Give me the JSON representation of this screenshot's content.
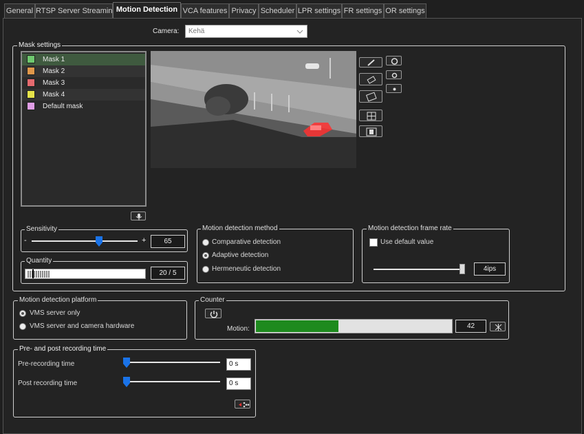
{
  "tabs": [
    "General",
    "RTSP Server Streaming",
    "Motion Detection",
    "VCA features",
    "Privacy",
    "Scheduler",
    "LPR settings",
    "FR settings",
    "OR settings"
  ],
  "active_tab": "Motion Detection",
  "camera": {
    "label": "Camera:",
    "value": "Kehä"
  },
  "mask_settings": {
    "legend": "Mask settings",
    "masks": [
      {
        "label": "Mask 1",
        "color": "#6fc96f",
        "selected": true
      },
      {
        "label": "Mask 2",
        "color": "#e0974a"
      },
      {
        "label": "Mask 3",
        "color": "#e56a6f"
      },
      {
        "label": "Mask 4",
        "color": "#e6e34a"
      },
      {
        "label": "Default mask",
        "color": "#e09ee6"
      }
    ]
  },
  "sensitivity": {
    "legend": "Sensitivity",
    "value": "65",
    "minus": "-",
    "plus": "+",
    "level_percent": 65
  },
  "quantity": {
    "legend": "Quantity",
    "value": "20 / 5"
  },
  "method": {
    "legend": "Motion detection method",
    "options": [
      "Comparative detection",
      "Adaptive detection",
      "Hermeneutic detection"
    ],
    "selected": "Adaptive detection"
  },
  "frame_rate": {
    "legend": "Motion detection frame rate",
    "checkbox_label": "Use default value",
    "checked": false,
    "value": "4ips"
  },
  "platform": {
    "legend": "Motion detection platform",
    "options": [
      "VMS server only",
      "VMS server and camera hardware"
    ],
    "selected": "VMS server only"
  },
  "counter": {
    "legend": "Counter",
    "motion_label": "Motion:",
    "value": "42",
    "level_percent": 42,
    "bar_color": "#1e8a1e"
  },
  "recording": {
    "legend": "Pre- and post recording time",
    "pre_label": "Pre-recording time",
    "pre_value": "0 s",
    "post_label": "Post recording time",
    "post_value": "0 s"
  },
  "icons": {
    "pencil": "pencil-icon",
    "eraser": "eraser-icon",
    "fill": "fill-icon",
    "grid": "grid-icon",
    "film": "film-icon",
    "reset": "reset-icon",
    "power": "power-icon",
    "expand": "expand-icon",
    "arrows": "move-arrows-icon",
    "mic": "microphone-icon"
  }
}
